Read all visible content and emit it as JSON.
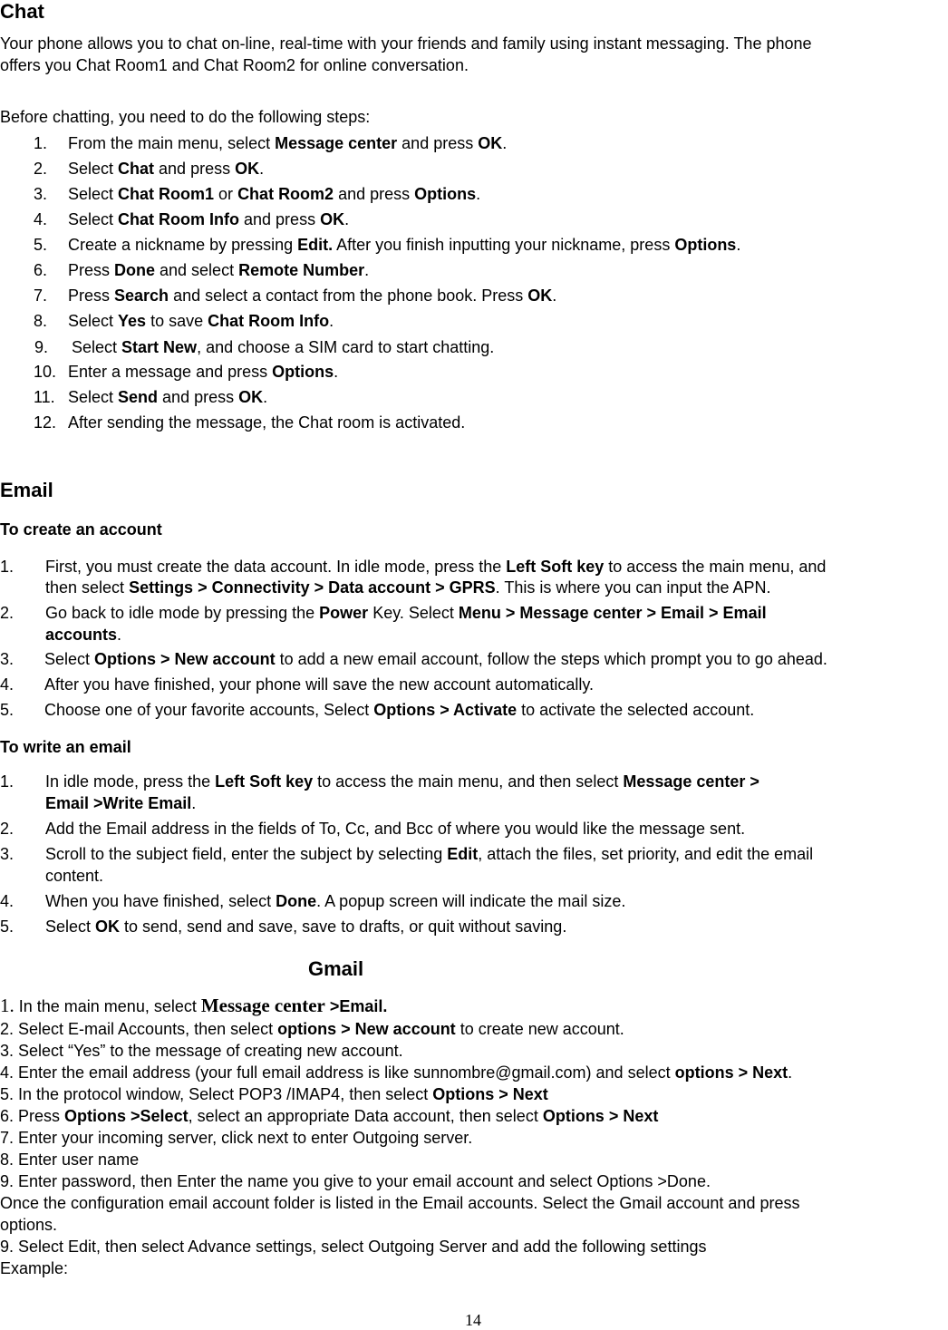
{
  "chat": {
    "title": "Chat",
    "intro_line1": "Your phone allows you to chat on-line, real-time with your friends and family using instant messaging. The phone",
    "intro_line2": "offers you Chat Room1 and Chat Room2 for online conversation.",
    "before": "Before chatting, you need to do the following steps:",
    "steps": [
      {
        "num": "1.",
        "parts": [
          [
            "From the main menu, select ",
            false
          ],
          [
            "Message center",
            true
          ],
          [
            " and press ",
            false
          ],
          [
            "OK",
            true
          ],
          [
            ".",
            false
          ]
        ]
      },
      {
        "num": "2.",
        "parts": [
          [
            "Select ",
            false
          ],
          [
            "Chat",
            true
          ],
          [
            " and press ",
            false
          ],
          [
            "OK",
            true
          ],
          [
            ".",
            false
          ]
        ]
      },
      {
        "num": "3.",
        "parts": [
          [
            "Select ",
            false
          ],
          [
            "Chat Room1",
            true
          ],
          [
            " or ",
            false
          ],
          [
            "Chat Room2",
            true
          ],
          [
            " and press ",
            false
          ],
          [
            "Options",
            true
          ],
          [
            ".",
            false
          ]
        ]
      },
      {
        "num": "4.",
        "parts": [
          [
            "Select ",
            false
          ],
          [
            "Chat Room Info",
            true
          ],
          [
            " and press ",
            false
          ],
          [
            "OK",
            true
          ],
          [
            ".",
            false
          ]
        ]
      },
      {
        "num": "5.",
        "parts": [
          [
            "Create a nickname by pressing ",
            false
          ],
          [
            "Edit.",
            true
          ],
          [
            " After you finish inputting your nickname, press ",
            false
          ],
          [
            "Options",
            true
          ],
          [
            ".",
            false
          ]
        ]
      },
      {
        "num": "6.",
        "parts": [
          [
            "Press ",
            false
          ],
          [
            "Done",
            true
          ],
          [
            " and select ",
            false
          ],
          [
            "Remote Number",
            true
          ],
          [
            ".",
            false
          ]
        ]
      },
      {
        "num": "7.",
        "parts": [
          [
            "Press ",
            false
          ],
          [
            "Search",
            true
          ],
          [
            " and select a contact from the phone book. Press ",
            false
          ],
          [
            "OK",
            true
          ],
          [
            ".",
            false
          ]
        ]
      },
      {
        "num": "8.",
        "parts": [
          [
            "Select ",
            false
          ],
          [
            "Yes",
            true
          ],
          [
            " to save ",
            false
          ],
          [
            "Chat Room Info",
            true
          ],
          [
            ".",
            false
          ]
        ]
      },
      {
        "num": "9.",
        "parts": [
          [
            "Select ",
            false
          ],
          [
            "Start New",
            true
          ],
          [
            ", and choose a SIM card to start chatting.",
            false
          ]
        ]
      },
      {
        "num": "10.",
        "parts": [
          [
            "Enter a message and press ",
            false
          ],
          [
            "Options",
            true
          ],
          [
            ".",
            false
          ]
        ]
      },
      {
        "num": "11.",
        "parts": [
          [
            "Select ",
            false
          ],
          [
            "Send",
            true
          ],
          [
            " and press ",
            false
          ],
          [
            "OK",
            true
          ],
          [
            ".",
            false
          ]
        ]
      },
      {
        "num": "12.",
        "parts": [
          [
            "After sending the message, the Chat room is activated.",
            false
          ]
        ]
      }
    ]
  },
  "email": {
    "title": "Email",
    "create_heading": "To create an account",
    "create_steps": [
      {
        "num": "1.",
        "lines": [
          [
            [
              "First, you must create the data account. In idle mode, press the ",
              false
            ],
            [
              "Left Soft key",
              true
            ],
            [
              " to access the main menu, and",
              false
            ]
          ],
          [
            [
              "then select ",
              false
            ],
            [
              "Settings > Connectivity > Data account > GPRS",
              true
            ],
            [
              ". This is where you can input the APN.",
              false
            ]
          ]
        ]
      },
      {
        "num": "2.",
        "lines": [
          [
            [
              "Go back to idle mode by pressing the ",
              false
            ],
            [
              "Power",
              true
            ],
            [
              " Key. Select ",
              false
            ],
            [
              "Menu > Message center > Email > Email",
              true
            ]
          ],
          [
            [
              "accounts",
              true
            ],
            [
              ".",
              false
            ]
          ]
        ]
      },
      {
        "num": "3.",
        "lines": [
          [
            [
              "Select ",
              false
            ],
            [
              "Options > New account",
              true
            ],
            [
              " to add a new email account, follow the steps which prompt you to go ahead.",
              false
            ]
          ]
        ]
      },
      {
        "num": "4.",
        "lines": [
          [
            [
              "After you have finished, your phone will save the new account automatically.",
              false
            ]
          ]
        ]
      },
      {
        "num": "5.",
        "lines": [
          [
            [
              "Choose one of your favorite accounts, Select ",
              false
            ],
            [
              "Options > Activate",
              true
            ],
            [
              " to activate the selected account.",
              false
            ]
          ]
        ]
      }
    ],
    "write_heading": "To write an email",
    "write_steps": [
      {
        "num": "1.",
        "lines": [
          [
            [
              "In idle mode, press the ",
              false
            ],
            [
              "Left Soft key",
              true
            ],
            [
              " to access the main menu, and then select ",
              false
            ],
            [
              "Message center >",
              true
            ]
          ],
          [
            [
              "Email >Write Email",
              true
            ],
            [
              ".",
              false
            ]
          ]
        ]
      },
      {
        "num": "2.",
        "lines": [
          [
            [
              "Add the Email address in the fields of To, Cc, and Bcc of where you would like the message sent.",
              false
            ]
          ]
        ]
      },
      {
        "num": "3.",
        "lines": [
          [
            [
              "Scroll to the subject field, enter the subject by selecting ",
              false
            ],
            [
              "Edit",
              true
            ],
            [
              ", attach the files, set priority, and edit the email",
              false
            ]
          ],
          [
            [
              "content.",
              false
            ]
          ]
        ]
      },
      {
        "num": "4.",
        "lines": [
          [
            [
              "When you have finished, select ",
              false
            ],
            [
              "Done",
              true
            ],
            [
              ". A popup screen will indicate the mail size.",
              false
            ]
          ]
        ]
      },
      {
        "num": "5.",
        "lines": [
          [
            [
              "Select ",
              false
            ],
            [
              "OK",
              true
            ],
            [
              " to send, send and save, save to drafts, or quit without saving.",
              false
            ]
          ]
        ]
      }
    ]
  },
  "gmail": {
    "title": "Gmail",
    "lines": [
      [
        [
          "1.",
          "serif-num"
        ],
        [
          " In the main menu, select ",
          ""
        ],
        [
          "Message center",
          "serif-b"
        ],
        [
          " >Email.",
          "b"
        ]
      ],
      [
        [
          "2. Select E-mail Accounts, then select ",
          ""
        ],
        [
          "options > New account",
          "b"
        ],
        [
          " to create new account.",
          ""
        ]
      ],
      [
        [
          "3. Select “Yes” to the message of creating new account.",
          ""
        ]
      ],
      [
        [
          "4. Enter the email address (your full email address is like sunnombre@gmail.com) and select ",
          ""
        ],
        [
          "options > Next",
          "b"
        ],
        [
          ".",
          ""
        ]
      ],
      [
        [
          "5. In the protocol window, Select POP3 /IMAP4, then select ",
          ""
        ],
        [
          "Options > Next",
          "b"
        ]
      ],
      [
        [
          "6. Press ",
          ""
        ],
        [
          "Options >Select",
          "b"
        ],
        [
          ", select an appropriate Data account, then select ",
          ""
        ],
        [
          "Options > Next",
          "b"
        ]
      ],
      [
        [
          "7. Enter your incoming server, click next to enter Outgoing server.",
          ""
        ]
      ],
      [
        [
          "8. Enter user name",
          ""
        ]
      ],
      [
        [
          "9. Enter password, then Enter the name you give to your email account and select Options >Done.",
          ""
        ]
      ],
      [
        [
          "Once the configuration email account folder is listed in the Email accounts. Select the Gmail account and press",
          ""
        ]
      ],
      [
        [
          "options.",
          ""
        ]
      ],
      [
        [
          "9. Select Edit, then select Advance settings, select Outgoing Server and add the following settings",
          ""
        ]
      ],
      [
        [
          "Example:",
          ""
        ]
      ]
    ]
  },
  "page_number": "14"
}
